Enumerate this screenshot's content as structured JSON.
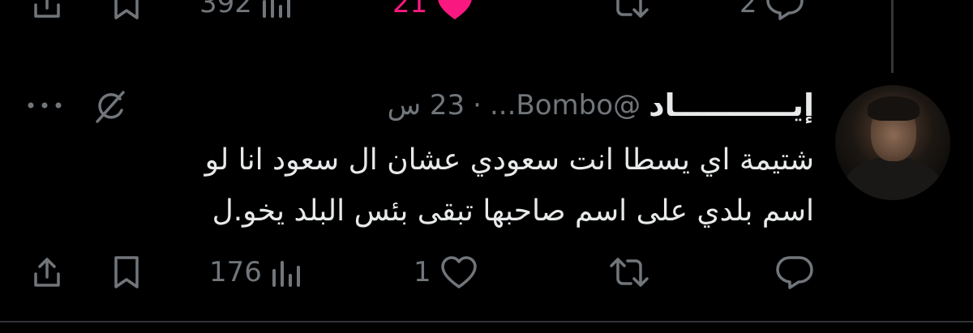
{
  "prev_actions": {
    "views": "392",
    "likes": "21",
    "reposts": "",
    "replies": "2"
  },
  "tweet": {
    "display_name": "إيـــــــــــاد",
    "handle": "@Bombo...",
    "separator": "·",
    "time": "23 س",
    "text_line_1": "شتيمة اي يسطا انت سعودي عشان ال سعود انا لو",
    "text_line_2": "اسم بلدي على اسم صاحبها تبقى بئس البلد يخو.ل",
    "actions": {
      "views": "176",
      "likes": "1",
      "reposts": "",
      "replies": ""
    }
  },
  "colors": {
    "background": "#000000",
    "text": "#e7e9ea",
    "secondary": "#71767b",
    "like_active": "#f91880"
  }
}
